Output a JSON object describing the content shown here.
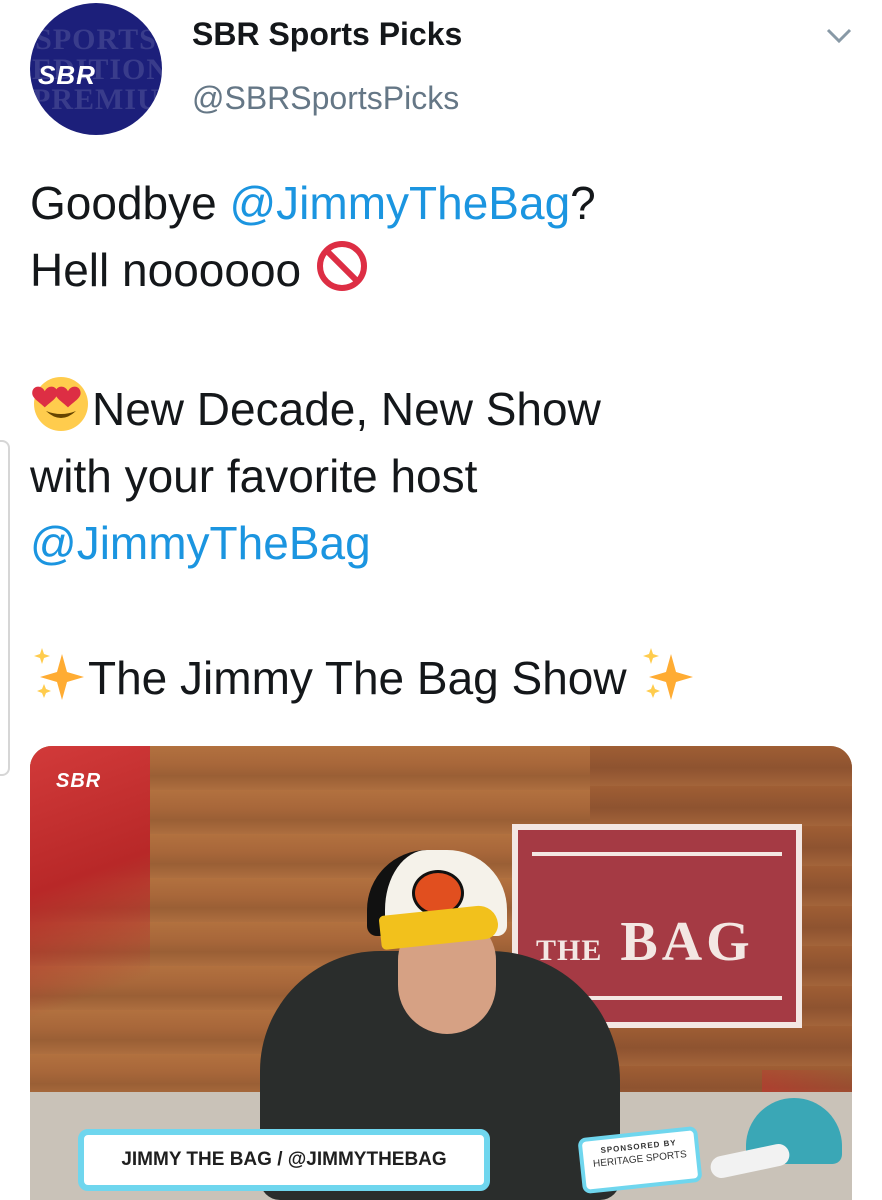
{
  "header": {
    "avatar": {
      "logo_text": "SBR",
      "background_text": "SPORTS\nEDITION\nPREMIUM",
      "color": "#1c1f7a"
    },
    "display_name": "SBR Sports Picks",
    "handle": "@SBRSportsPicks",
    "menu_icon": "chevron-down-icon"
  },
  "tweet": {
    "line1_pre": "Goodbye ",
    "mention1": "@JimmyTheBag",
    "line1_post": "?",
    "line2": "Hell noooooo",
    "emoji_prohibited": "no-entry-icon",
    "line3": "New Decade, New Show",
    "emoji_heart_eyes": "heart-eyes-icon",
    "line4": "with your favorite host",
    "mention2": "@JimmyTheBag",
    "line5": "The Jimmy The Bag Show",
    "emoji_sparkles": "sparkles-icon"
  },
  "media": {
    "corner_logo": "SBR",
    "sign_prefix": "THE",
    "sign_word": "BAG",
    "lower_third": "JIMMY THE BAG / @JIMMYTHEBAG",
    "sponsor_line1": "SPONSORED BY",
    "sponsor_line2": "HERITAGE SPORTS"
  },
  "colors": {
    "link": "#1b95e0",
    "handle_gray": "#657786",
    "text": "#14171a"
  }
}
